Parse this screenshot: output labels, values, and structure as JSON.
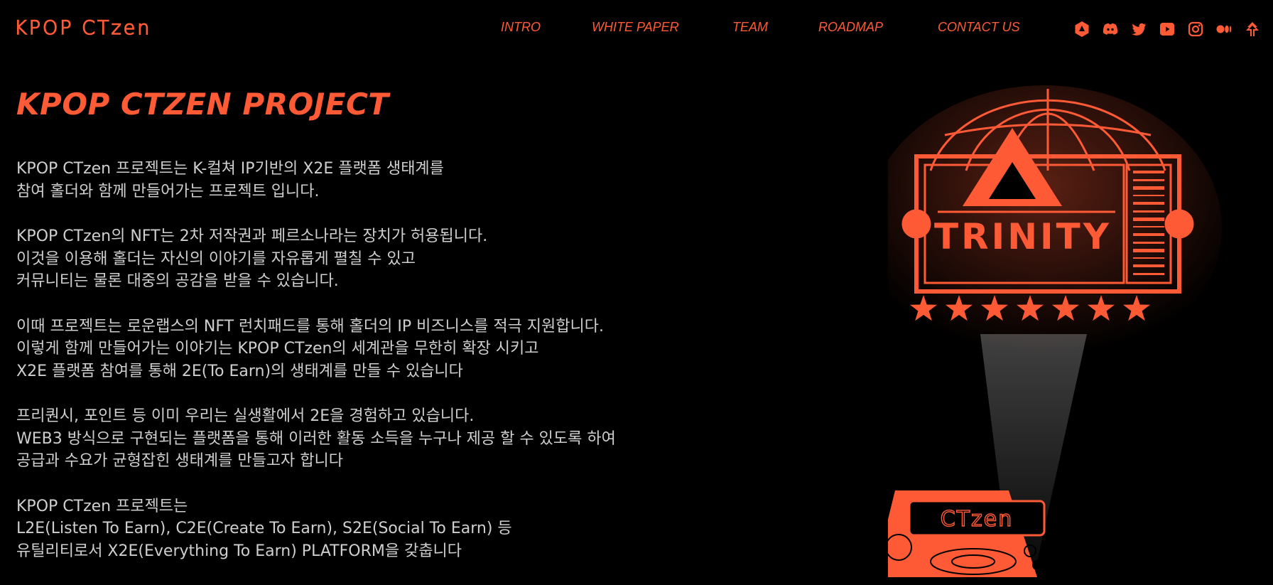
{
  "header": {
    "logo_text": "KPOP CTzen",
    "nav": [
      {
        "label": "INTRO"
      },
      {
        "label": "WHITE PAPER"
      },
      {
        "label": "TEAM"
      },
      {
        "label": "ROADMAP"
      },
      {
        "label": "CONTACT US"
      }
    ],
    "socials": [
      "opensea-icon",
      "discord-icon",
      "twitter-icon",
      "youtube-icon",
      "instagram-icon",
      "medium-icon",
      "linktree-icon"
    ]
  },
  "main": {
    "title": "KPOP CTZEN PROJECT",
    "paragraphs": [
      [
        "KPOP CTzen 프로젝트는 K-컬쳐 IP기반의 X2E 플랫폼 생태계를",
        "참여 홀더와 함께 만들어가는 프로젝트 입니다."
      ],
      [
        "KPOP CTzen의 NFT는 2차 저작권과 페르소나라는 장치가 허용됩니다.",
        "이것을 이용해 홀더는 자신의 이야기를 자유롭게 펼칠 수 있고",
        "커뮤니티는 물론 대중의 공감을 받을 수 있습니다."
      ],
      [
        "이때 프로젝트는 로운랩스의 NFT 런치패드를 통해 홀더의 IP 비즈니스를 적극 지원합니다.",
        "이렇게 함께 만들어가는 이야기는 KPOP CTzen의 세계관을 무한히 확장 시키고",
        "X2E 플랫폼 참여를 통해 2E(To Earn)의 생태계를 만들 수 있습니다"
      ],
      [
        "프리퀀시, 포인트 등 이미 우리는 실생활에서 2E을 경험하고 있습니다.",
        "WEB3 방식으로 구현되는 플랫폼을 통해 이러한 활동 소득을 누구나 제공 할 수 있도록 하여",
        "공급과 수요가 균형잡힌 생태계를 만들고자 합니다"
      ],
      [
        "KPOP CTzen 프로젝트는",
        "L2E(Listen To Earn), C2E(Create To Earn), S2E(Social To Earn) 등",
        "유틸리티로서 X2E(Everything To Earn) PLATFORM을 갖춥니다"
      ]
    ]
  },
  "illustration": {
    "ticket_text": "TRINITY",
    "device_text": "CTzen",
    "star_count": 7
  },
  "colors": {
    "accent": "#ff5a36",
    "background": "#000000",
    "text": "#cfcfcf"
  }
}
